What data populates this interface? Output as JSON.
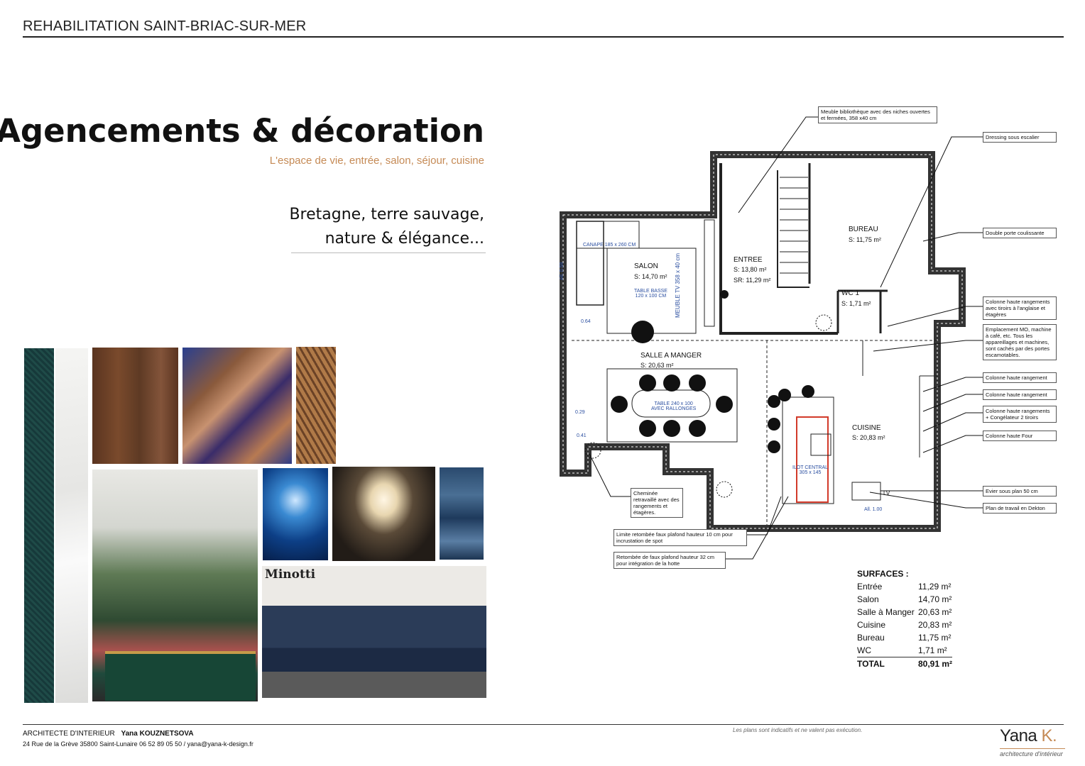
{
  "header": {
    "title": "REHABILITATION SAINT-BRIAC-SUR-MER"
  },
  "intro": {
    "title": "Agencements & décoration",
    "subtitle": "L'espace de vie, entrée, salon, séjour, cuisine",
    "tagline_line1": "Bretagne, terre sauvage,",
    "tagline_line2": "nature & élégance..."
  },
  "moodboard": {
    "minotti_label": "Minotti"
  },
  "plan": {
    "rooms": {
      "salon": "SALON",
      "salon_s": "S: 14,70 m²",
      "entree": "ENTREE",
      "entree_s": "S:   13,80 m²",
      "entree_sr": "SR: 11,29 m²",
      "bureau": "BUREAU",
      "bureau_s": "S: 11,75 m²",
      "wc": "WC 1",
      "wc_s": "S: 1,71 m²",
      "salle": "SALLE A MANGER",
      "salle_s": "S:          20,63 m²",
      "cuisine": "CUISINE",
      "cuisine_s": "S: 20,83 m²"
    },
    "labels": {
      "canape": "CANAPE 185 x 260 CM",
      "table_basse": "TABLE BASSE\n120 x 100 CM",
      "meuble_tv": "MEUBLE TV 358 x 40 cm",
      "table": "TABLE 240 x 100\nAVEC RALLONGES",
      "ilot": "ILOT CENTRAL\n305 x 145",
      "lv": "LV",
      "all_058": "All. 0.58",
      "all_100": "All. 1.00",
      "d064": "0.64",
      "d029": "0.29",
      "d041": "0.41"
    },
    "callouts": {
      "bibliotheque": "Meuble bibliothèque avec des niches ouvertes et fermées, 358 x40 cm",
      "dressing": "Dressing sous escalier",
      "double_porte": "Double porte coulissante",
      "colonne_anglaise": "Colonne haute rangements avec tiroirs à l'anglaise et étagères",
      "emplacement": "Emplacement MO, machine à café, etc. Tous les appareillages et machines, sont cachés par des portes escamotables.",
      "colonne1": "Colonne haute rangement",
      "colonne2": "Colonne haute rangement",
      "colonne_congel": "Colonne haute rangements + Congélateur 2 tiroirs",
      "four": "Colonne haute Four",
      "evier": "Evier sous plan 50 cm",
      "dekton": "Plan de travail en Dekton",
      "cheminee": "Cheminée retravaillé avec des rangements et étagères.",
      "limite": "Limite retombée faux plafond hauteur 10 cm pour incrustation de spot",
      "retombee": "Retombée de faux plafond hauteur 32 cm pour intégration de la hotte"
    }
  },
  "surfaces": {
    "title": "SURFACES :",
    "rows": [
      {
        "name": "Entrée",
        "value": "11,29 m²"
      },
      {
        "name": "Salon",
        "value": "14,70 m²"
      },
      {
        "name": "Salle à Manger",
        "value": "20,63 m²"
      },
      {
        "name": "Cuisine",
        "value": "20,83 m²"
      },
      {
        "name": "Bureau",
        "value": "11,75 m²"
      },
      {
        "name": "WC",
        "value": "1,71 m²"
      }
    ],
    "total_label": "TOTAL",
    "total_value": "80,91 m²"
  },
  "footer": {
    "role": "ARCHITECTE D'INTERIEUR",
    "name": "Yana KOUZNETSOVA",
    "address": "24 Rue de la Grève 35800 Saint-Lunaire   06 52 89 05 50 / yana@yana-k-design.fr",
    "disclaimer": "Les plans sont indicatifs et ne valent pas exécution.",
    "logo_name": "Yana",
    "logo_k": "K.",
    "logo_sub": "architecture d'intérieur"
  }
}
